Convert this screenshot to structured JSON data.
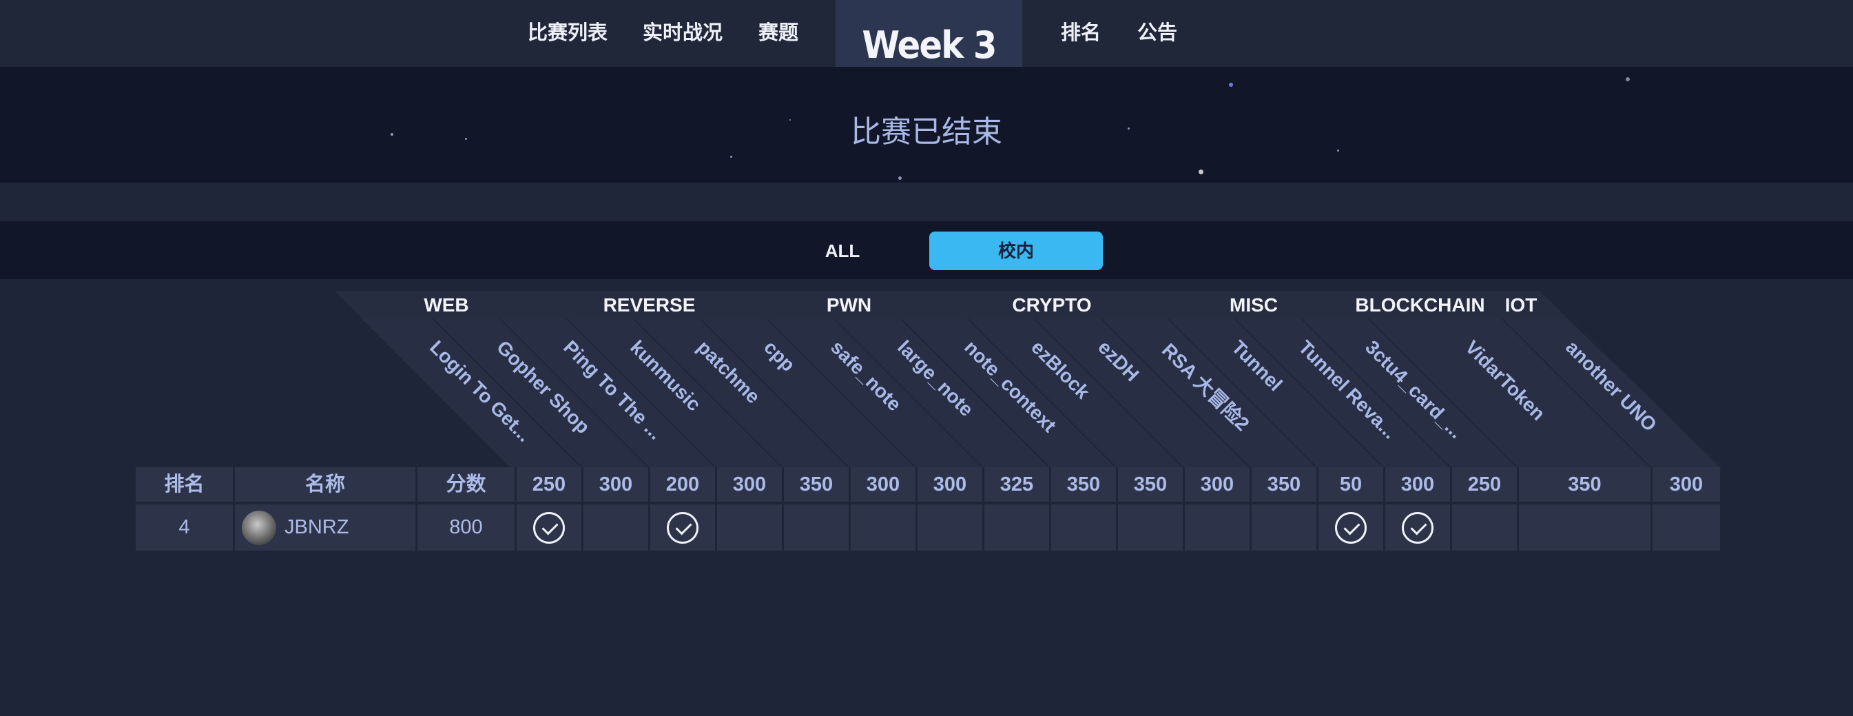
{
  "nav": {
    "items_left": [
      "比赛列表",
      "实时战况",
      "赛题"
    ],
    "center_title": "Week 3",
    "items_right": [
      "排名",
      "公告"
    ]
  },
  "hero": {
    "status": "比赛已结束"
  },
  "filters": {
    "all": "ALL",
    "school": "校内",
    "active": "校内"
  },
  "categories": [
    "WEB",
    "REVERSE",
    "PWN",
    "CRYPTO",
    "MISC",
    "BLOCKCHAIN",
    "IOT"
  ],
  "challenges": [
    "Login To Get...",
    "Gopher Shop",
    "Ping To The ...",
    "kunmusic",
    "patchme",
    "cpp",
    "safe_note",
    "large_note",
    "note_context",
    "ezBlock",
    "ezDH",
    "RSA 大冒险2",
    "Tunnel",
    "Tunnel Reva...",
    "3ctu4_card_...",
    "VidarToken",
    "another UNO"
  ],
  "table": {
    "headers": {
      "rank": "排名",
      "name": "名称",
      "score": "分数"
    },
    "points": [
      "250",
      "300",
      "200",
      "300",
      "350",
      "300",
      "300",
      "325",
      "350",
      "350",
      "300",
      "350",
      "50",
      "300",
      "250",
      "350",
      "300"
    ],
    "rows": [
      {
        "rank": "4",
        "name": "JBNRZ",
        "score": "800",
        "solved": [
          true,
          false,
          true,
          false,
          false,
          false,
          false,
          false,
          false,
          false,
          false,
          false,
          true,
          true,
          false,
          false,
          false
        ]
      }
    ]
  },
  "colors": {
    "accent": "#39b8f2",
    "nav_bg": "#1f2739",
    "hero_bg": "#111728",
    "cell_bg": "#2d3449",
    "header_text": "#aebbe8"
  }
}
